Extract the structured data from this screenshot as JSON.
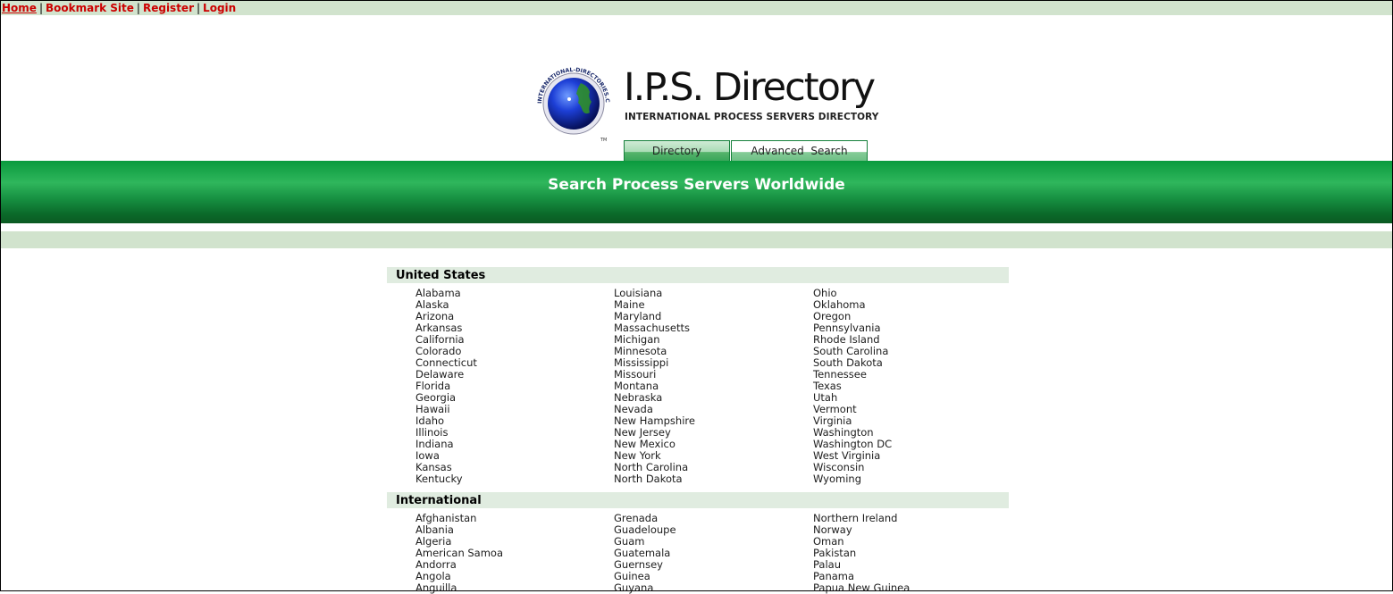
{
  "nav": {
    "links": [
      "Home",
      "Bookmark Site",
      "Register",
      "Login"
    ],
    "separator": "|"
  },
  "logo": {
    "title": "I.P.S. Directory",
    "subtitle": "INTERNATIONAL PROCESS SERVERS DIRECTORY",
    "ring_text": "INTERNATIONAL-DIRECTORIES.COM",
    "tm": "TM"
  },
  "tabs": {
    "directory": "Directory",
    "advanced_search": "Advanced  Search"
  },
  "banner": {
    "title": "Search Process Servers Worldwide"
  },
  "colors": {
    "nav_bg": "#d1e3cd",
    "nav_link": "#cc0000",
    "banner_green": "#0a9a3e",
    "section_bg": "#e0ece0"
  },
  "us": {
    "heading": "United States",
    "col1": [
      "Alabama",
      "Alaska",
      "Arizona",
      "Arkansas",
      "California",
      "Colorado",
      "Connecticut",
      "Delaware",
      "Florida",
      "Georgia",
      "Hawaii",
      "Idaho",
      "Illinois",
      "Indiana",
      "Iowa",
      "Kansas",
      "Kentucky"
    ],
    "col2": [
      "Louisiana",
      "Maine",
      "Maryland",
      "Massachusetts",
      "Michigan",
      "Minnesota",
      "Mississippi",
      "Missouri",
      "Montana",
      "Nebraska",
      "Nevada",
      "New Hampshire",
      "New Jersey",
      "New Mexico",
      "New York",
      "North Carolina",
      "North Dakota"
    ],
    "col3": [
      "Ohio",
      "Oklahoma",
      "Oregon",
      "Pennsylvania",
      "Rhode Island",
      "South Carolina",
      "South Dakota",
      "Tennessee",
      "Texas",
      "Utah",
      "Vermont",
      "Virginia",
      "Washington",
      "Washington DC",
      "West Virginia",
      "Wisconsin",
      "Wyoming"
    ]
  },
  "intl": {
    "heading": "International",
    "col1": [
      "Afghanistan",
      "Albania",
      "Algeria",
      "American Samoa",
      "Andorra",
      "Angola",
      "Anguilla"
    ],
    "col2": [
      "Grenada",
      "Guadeloupe",
      "Guam",
      "Guatemala",
      "Guernsey",
      "Guinea",
      "Guyana"
    ],
    "col3": [
      "Northern Ireland",
      "Norway",
      "Oman",
      "Pakistan",
      "Palau",
      "Panama",
      "Papua New Guinea"
    ]
  }
}
